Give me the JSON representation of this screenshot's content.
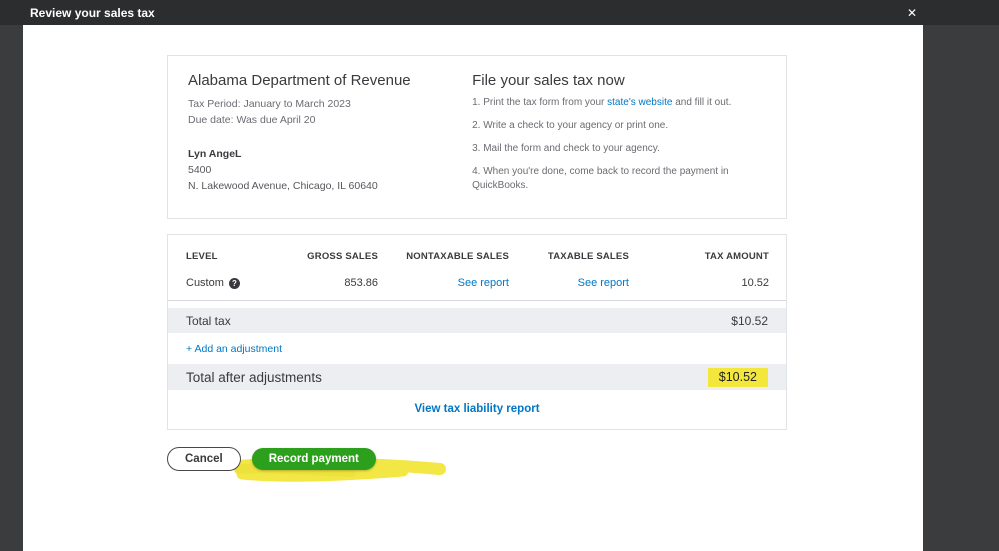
{
  "modal": {
    "title": "Review your sales tax"
  },
  "icons": {
    "close": "✕",
    "help": "?"
  },
  "agency": {
    "name": "Alabama Department of Revenue",
    "tax_period": "Tax Period: January to March 2023",
    "due_date": "Due date:  Was due April 20",
    "payer_name": "Lyn AngeL",
    "address_line1": "5400",
    "address_line2": "N. Lakewood Avenue, Chicago, IL 60640"
  },
  "instructions": {
    "title": "File your sales tax now",
    "step1_prefix": "1. Print the tax form from your ",
    "step1_link": "state's website",
    "step1_suffix": " and fill it out.",
    "step2": "2. Write a check to your agency or print one.",
    "step3": "3. Mail the form and check to your agency.",
    "step4": "4. When you're done, come back to record the payment in QuickBooks."
  },
  "tax_table": {
    "headers": {
      "level": "LEVEL",
      "gross_sales": "GROSS SALES",
      "nontaxable_sales": "NONTAXABLE SALES",
      "taxable_sales": "TAXABLE SALES",
      "tax_amount": "TAX AMOUNT"
    },
    "row": {
      "level": "Custom",
      "gross_sales": "853.86",
      "nontaxable_sales_link": "See report",
      "taxable_sales_link": "See report",
      "tax_amount": "10.52"
    },
    "total_tax": {
      "label": "Total tax",
      "value": "$10.52"
    },
    "add_adjustment_link": "+ Add an adjustment",
    "total_after_adjustments": {
      "label": "Total after adjustments",
      "value": "$10.52"
    },
    "view_report_link": "View tax liability report"
  },
  "actions": {
    "cancel": "Cancel",
    "record_payment": "Record payment"
  },
  "colors": {
    "qb_green": "#2ca01c",
    "link_blue": "#0077c5",
    "highlight_yellow": "#f2e73a",
    "header_dark": "#2c2d2f",
    "backdrop_dark": "#3b3c3e"
  }
}
